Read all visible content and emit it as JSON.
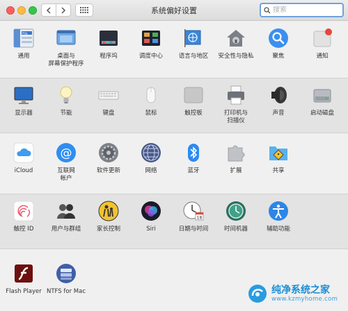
{
  "window": {
    "title": "系统偏好设置"
  },
  "search": {
    "placeholder": "搜索",
    "value": ""
  },
  "sections": [
    {
      "panes": [
        {
          "name": "general",
          "label": "通用"
        },
        {
          "name": "desktop",
          "label": "桌面与\n屏幕保护程序"
        },
        {
          "name": "dock",
          "label": "程序坞"
        },
        {
          "name": "mission-control",
          "label": "调度中心"
        },
        {
          "name": "language",
          "label": "语言与地区"
        },
        {
          "name": "security",
          "label": "安全性与隐私"
        },
        {
          "name": "spotlight",
          "label": "聚焦"
        },
        {
          "name": "notifications",
          "label": "通知"
        }
      ]
    },
    {
      "panes": [
        {
          "name": "displays",
          "label": "显示器"
        },
        {
          "name": "energy",
          "label": "节能"
        },
        {
          "name": "keyboard",
          "label": "键盘"
        },
        {
          "name": "mouse",
          "label": "鼠标"
        },
        {
          "name": "trackpad",
          "label": "触控板"
        },
        {
          "name": "printers",
          "label": "打印机与\n扫描仪"
        },
        {
          "name": "sound",
          "label": "声音"
        },
        {
          "name": "startup-disk",
          "label": "启动磁盘"
        }
      ]
    },
    {
      "panes": [
        {
          "name": "icloud",
          "label": "iCloud"
        },
        {
          "name": "internet-accounts",
          "label": "互联网\n帐户"
        },
        {
          "name": "software-update",
          "label": "软件更新"
        },
        {
          "name": "network",
          "label": "网络"
        },
        {
          "name": "bluetooth",
          "label": "蓝牙"
        },
        {
          "name": "extensions",
          "label": "扩展"
        },
        {
          "name": "sharing",
          "label": "共享"
        }
      ]
    },
    {
      "panes": [
        {
          "name": "touch-id",
          "label": "触控 ID"
        },
        {
          "name": "users-groups",
          "label": "用户与群组"
        },
        {
          "name": "parental-controls",
          "label": "家长控制"
        },
        {
          "name": "siri",
          "label": "Siri"
        },
        {
          "name": "date-time",
          "label": "日期与时间"
        },
        {
          "name": "time-machine",
          "label": "时间机器"
        },
        {
          "name": "accessibility",
          "label": "辅助功能"
        }
      ]
    },
    {
      "panes": [
        {
          "name": "flash-player",
          "label": "Flash Player"
        },
        {
          "name": "ntfs-for-mac",
          "label": "NTFS for Mac"
        }
      ]
    }
  ],
  "watermark": {
    "text": "纯净系统之家",
    "url": "www.kzmyhome.com"
  },
  "colors": {
    "accent": "#3478f6",
    "search_focus": "#6ea2dd"
  }
}
